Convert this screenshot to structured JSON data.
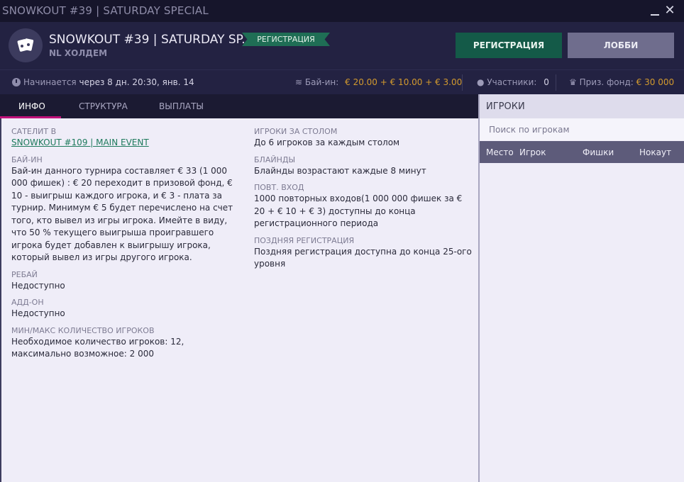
{
  "window": {
    "title": "SNOWKOUT #39 | SATURDAY SPECIAL"
  },
  "header": {
    "title": "SNOWKOUT #39 | SATURDAY SP...",
    "game": "NL ХОЛДЕМ",
    "status": "РЕГИСТРАЦИЯ",
    "register_label": "РЕГИСТРАЦИЯ",
    "lobby_label": "ЛОББИ"
  },
  "infobar": {
    "starts_label": "Начинается",
    "starts_value": "через 8 дн.",
    "starts_time": "20:30, янв. 14",
    "buyin_label": "Бай-ин:",
    "buyin_value": "€ 20.00 + € 10.00 + € 3.00",
    "participants_label": "Участники:",
    "participants_value": "0",
    "prize_label": "Приз. фонд:",
    "prize_value": "€ 30 000"
  },
  "tabs": [
    "ИНФО",
    "СТРУКТУРА",
    "ВЫПЛАТЫ"
  ],
  "info": {
    "left": [
      {
        "label": "САТЕЛИТ В",
        "value": "SNOWKOUT #109 | MAIN EVENT"
      },
      {
        "label": "БАЙ-ИН",
        "value": "Бай-ин данного турнира составляет € 33 (1 000 000 фишек) : € 20 переходит в призовой фонд, € 10 - выигрыш каждого игрока, и € 3 - плата за турнир. Минимум € 5 будет перечислено на счет того, кто вывел из игры игрока. Имейте в виду, что 50 % текущего выигрыша проигравшего игрока будет добавлен к выигрышу игрока, который вывел из игры другого игрока."
      },
      {
        "label": "РЕБАЙ",
        "value": "Недоступно"
      },
      {
        "label": "АДД-ОН",
        "value": "Недоступно"
      },
      {
        "label": "МИН/МАКС КОЛИЧЕСТВО ИГРОКОВ",
        "value": "Необходимое количество игроков: 12, максимально возможное: 2 000"
      }
    ],
    "right": [
      {
        "label": "ИГРОКИ ЗА СТОЛОМ",
        "value": "До 6 игроков за каждым столом"
      },
      {
        "label": "БЛАЙНДЫ",
        "value": "Блайнды возрастают каждые 8 минут"
      },
      {
        "label": "ПОВТ. ВХОД",
        "value": "1000 повторных входов(1 000 000 фишек за € 20 + € 10 + € 3) доступны до конца регистрационного периода"
      },
      {
        "label": "ПОЗДНЯЯ РЕГИСТРАЦИЯ",
        "value": "Поздняя регистрация доступна до конца 25-ого уровня"
      }
    ]
  },
  "players": {
    "title": "ИГРОКИ",
    "search_placeholder": "Поиск по игрокам",
    "columns": [
      "Место",
      "Игрок",
      "Фишки",
      "Нокаут"
    ]
  },
  "colors": {
    "accent": "#c0117a",
    "primary": "#145a48",
    "gold": "#d39a2e"
  }
}
